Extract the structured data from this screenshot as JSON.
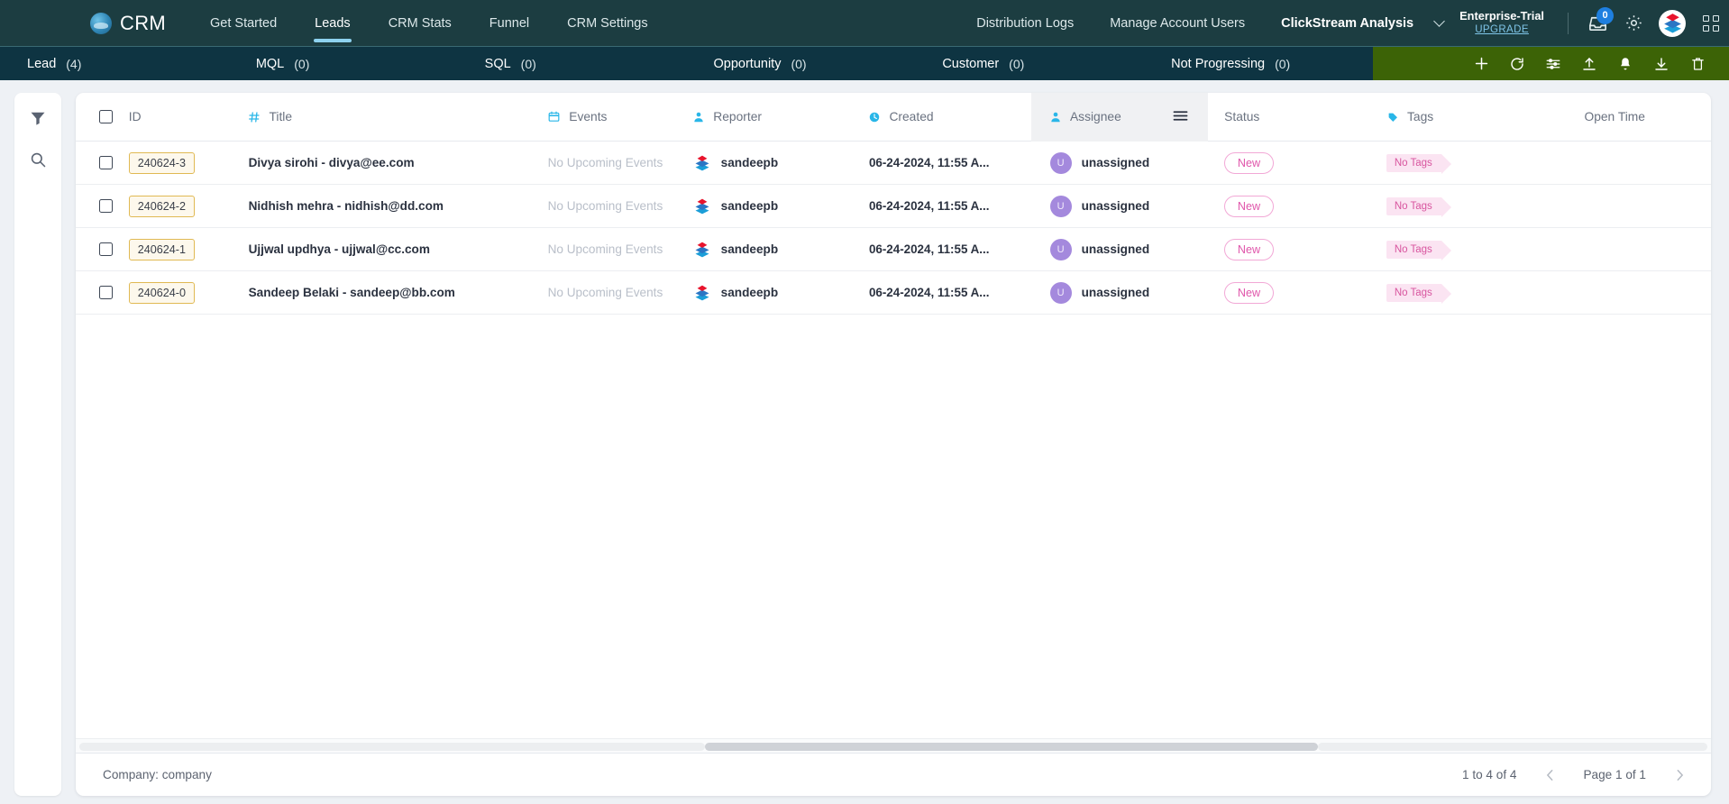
{
  "app": {
    "brand": "CRM",
    "logo_icon": "cloud-logo-icon"
  },
  "topnav": {
    "links": [
      {
        "label": "Get Started",
        "active": false
      },
      {
        "label": "Leads",
        "active": true
      },
      {
        "label": "CRM Stats",
        "active": false
      },
      {
        "label": "Funnel",
        "active": false
      },
      {
        "label": "CRM Settings",
        "active": false
      }
    ],
    "right_links": [
      {
        "label": "Distribution Logs",
        "bold": false
      },
      {
        "label": "Manage Account Users",
        "bold": false
      },
      {
        "label": "ClickStream Analysis",
        "bold": true
      }
    ],
    "plan": {
      "name": "Enterprise-Trial",
      "upgrade": "UPGRADE"
    },
    "icons": {
      "inbox": "inbox-download-icon",
      "inbox_count": "0",
      "settings": "gear-icon",
      "account_logo": "hexagon-brand-icon",
      "apps": "apps-grid-icon",
      "chevron": "chevron-down-icon"
    }
  },
  "stagebar": {
    "tabs": [
      {
        "label": "Lead",
        "count": "(4)"
      },
      {
        "label": "MQL",
        "count": "(0)"
      },
      {
        "label": "SQL",
        "count": "(0)"
      },
      {
        "label": "Opportunity",
        "count": "(0)"
      },
      {
        "label": "Customer",
        "count": "(0)"
      },
      {
        "label": "Not Progressing",
        "count": "(0)"
      }
    ],
    "actions": [
      {
        "name": "add-icon",
        "glyph": "+"
      },
      {
        "name": "refresh-icon",
        "glyph": "refresh"
      },
      {
        "name": "filter-settings-icon",
        "glyph": "sliders"
      },
      {
        "name": "upload-icon",
        "glyph": "upload"
      },
      {
        "name": "notification-bell-icon",
        "glyph": "bell"
      },
      {
        "name": "download-icon",
        "glyph": "download"
      },
      {
        "name": "delete-icon",
        "glyph": "trash"
      }
    ],
    "accent_color": "#3c6306"
  },
  "leftrail": {
    "items": [
      {
        "name": "filter-icon",
        "label": "Filter"
      },
      {
        "name": "search-icon",
        "label": "Search"
      }
    ]
  },
  "table": {
    "columns": [
      {
        "key": "checkbox",
        "label": "",
        "icon": "checkbox-icon"
      },
      {
        "key": "id",
        "label": "ID",
        "icon": ""
      },
      {
        "key": "title",
        "label": "Title",
        "icon": "hash-icon"
      },
      {
        "key": "events",
        "label": "Events",
        "icon": "calendar-icon"
      },
      {
        "key": "reporter",
        "label": "Reporter",
        "icon": "person-icon"
      },
      {
        "key": "created",
        "label": "Created",
        "icon": "clock-icon"
      },
      {
        "key": "assignee",
        "label": "Assignee",
        "icon": "person-icon",
        "menu_icon": "hamburger-menu-icon",
        "highlighted": true
      },
      {
        "key": "status",
        "label": "Status",
        "icon": ""
      },
      {
        "key": "tags",
        "label": "Tags",
        "icon": "tag-icon"
      },
      {
        "key": "open_time",
        "label": "Open Time",
        "icon": ""
      }
    ],
    "rows": [
      {
        "id": "240624-3",
        "title": "Divya sirohi - divya@ee.com",
        "events": "No Upcoming Events",
        "reporter": "sandeepb",
        "created": "06-24-2024, 11:55 A...",
        "assignee": "unassigned",
        "assignee_initial": "U",
        "status": "New",
        "tags": "No Tags",
        "open_time": ""
      },
      {
        "id": "240624-2",
        "title": "Nidhish mehra - nidhish@dd.com",
        "events": "No Upcoming Events",
        "reporter": "sandeepb",
        "created": "06-24-2024, 11:55 A...",
        "assignee": "unassigned",
        "assignee_initial": "U",
        "status": "New",
        "tags": "No Tags",
        "open_time": ""
      },
      {
        "id": "240624-1",
        "title": "Ujjwal updhya - ujjwal@cc.com",
        "events": "No Upcoming Events",
        "reporter": "sandeepb",
        "created": "06-24-2024, 11:55 A...",
        "assignee": "unassigned",
        "assignee_initial": "U",
        "status": "New",
        "tags": "No Tags",
        "open_time": ""
      },
      {
        "id": "240624-0",
        "title": "Sandeep Belaki - sandeep@bb.com",
        "events": "No Upcoming Events",
        "reporter": "sandeepb",
        "created": "06-24-2024, 11:55 A...",
        "assignee": "unassigned",
        "assignee_initial": "U",
        "status": "New",
        "tags": "No Tags",
        "open_time": ""
      }
    ]
  },
  "footer": {
    "company": "Company: company",
    "range": "1 to 4 of 4",
    "page": "Page 1 of 1",
    "prev_icon": "chevron-left-icon",
    "next_icon": "chevron-right-icon"
  },
  "colors": {
    "nav_bg": "#1c3d41",
    "stage_bg": "#0e3442",
    "action_green": "#3c6306",
    "accent_blue": "#29b6e8",
    "status_pink": "#e056ab",
    "id_amber": "#e0b953",
    "avatar_purple": "#a489dd"
  }
}
